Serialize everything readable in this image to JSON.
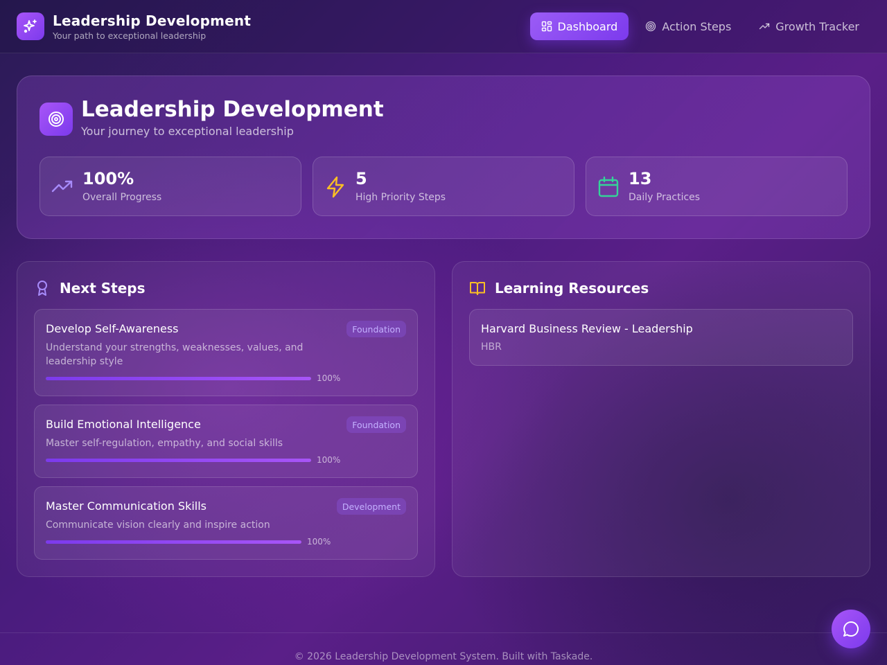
{
  "header": {
    "title": "Leadership Development",
    "subtitle": "Your path to exceptional leadership",
    "logo_icon": "sparkles-icon"
  },
  "nav": {
    "items": [
      {
        "label": "Dashboard",
        "icon": "dashboard-grid-icon",
        "active": true
      },
      {
        "label": "Action Steps",
        "icon": "target-icon",
        "active": false
      },
      {
        "label": "Growth Tracker",
        "icon": "trending-up-icon",
        "active": false
      }
    ]
  },
  "hero": {
    "title": "Leadership Development",
    "subtitle": "Your journey to exceptional leadership",
    "icon": "target-icon",
    "stats": [
      {
        "value": "100%",
        "label": "Overall Progress",
        "icon": "trending-up-icon",
        "color": "#a78bfa"
      },
      {
        "value": "5",
        "label": "High Priority Steps",
        "icon": "lightning-icon",
        "color": "#fbbf24"
      },
      {
        "value": "13",
        "label": "Daily Practices",
        "icon": "calendar-icon",
        "color": "#34d399"
      }
    ]
  },
  "next_steps": {
    "title": "Next Steps",
    "icon": "award-icon",
    "items": [
      {
        "title": "Develop Self-Awareness",
        "description": "Understand your strengths, weaknesses, values, and leadership style",
        "badge": "Foundation",
        "progress": 100,
        "progress_label": "100%"
      },
      {
        "title": "Build Emotional Intelligence",
        "description": "Master self-regulation, empathy, and social skills",
        "badge": "Foundation",
        "progress": 100,
        "progress_label": "100%"
      },
      {
        "title": "Master Communication Skills",
        "description": "Communicate vision clearly and inspire action",
        "badge": "Development",
        "progress": 100,
        "progress_label": "100%"
      }
    ]
  },
  "resources": {
    "title": "Learning Resources",
    "icon": "book-open-icon",
    "items": [
      {
        "title": "Harvard Business Review - Leadership",
        "source": "HBR"
      }
    ]
  },
  "footer": {
    "text": "© 2026 Leadership Development System. Built with Taskade."
  },
  "chat": {
    "icon": "chat-bubble-icon"
  },
  "colors": {
    "accent": "#8b5cf6",
    "accent_dark": "#7c3aed",
    "gold": "#fbbf24",
    "green": "#34d399"
  }
}
